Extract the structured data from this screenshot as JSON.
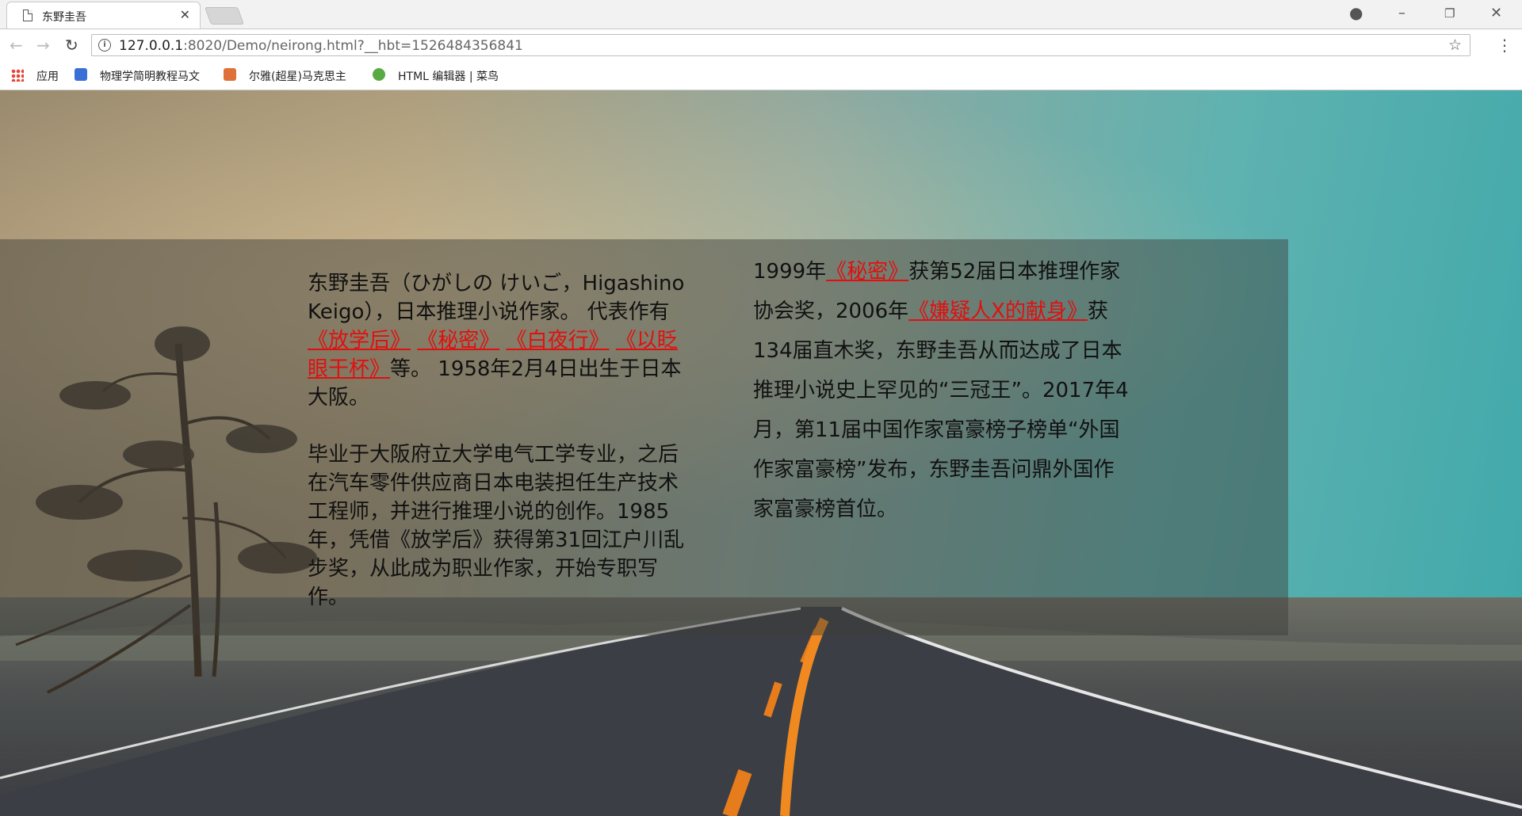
{
  "browser": {
    "tab_title": "东野圭吾",
    "url_host": "127.0.0.1",
    "url_rest": ":8020/Demo/neirong.html?__hbt=1526484356841",
    "bookmarks": {
      "apps": "应用",
      "item1": "物理学简明教程马文",
      "item2": "尔雅(超星)马克思主",
      "item3": "HTML 编辑器 | 菜鸟"
    }
  },
  "content": {
    "left": {
      "p1_intro": "东野圭吾（ひがしの けいご，Higashino Keigo），日本推理小说作家。 代表作有",
      "books": [
        "《放学后》",
        "《秘密》",
        "《白夜行》",
        "《以眨眼干杯》"
      ],
      "p1_outro": "等。 1958年2月4日出生于日本大阪。",
      "p2": "毕业于大阪府立大学电气工学专业，之后在汽车零件供应商日本电装担任生产技术工程师，并进行推理小说的创作。1985年，凭借《放学后》获得第31回江户川乱步奖，从此成为职业作家，开始专职写作。"
    },
    "right": {
      "t1": "1999年",
      "book1": "《秘密》",
      "t2": "获第52届日本推理作家协会奖，2006年",
      "book2": "《嫌疑人X的献身》",
      "t3": "获134届直木奖，东野圭吾从而达成了日本推理小说史上罕见的“三冠王”。2017年4月，第11届中国作家富豪榜子榜单“外国作家富豪榜”发布，东野圭吾问鼎外国作家富豪榜首位。"
    }
  },
  "colors": {
    "link": "#e01010",
    "overlay": "rgba(60,60,55,0.45)"
  }
}
